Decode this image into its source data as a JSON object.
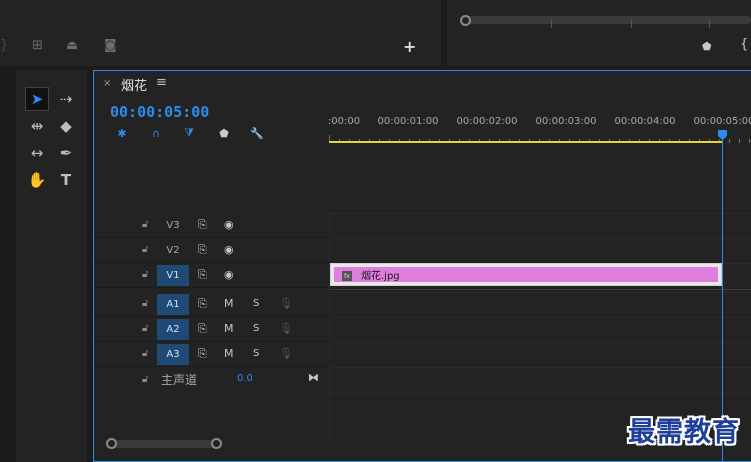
{
  "top_right": {
    "marker_icon": "marker-icon",
    "bracket_icon": "bracket-icon"
  },
  "top_left": {
    "add_label": "+"
  },
  "tools": [
    "selection-tool",
    "track-select-tool",
    "ripple-edit-tool",
    "razor-tool",
    "slip-tool",
    "pen-tool",
    "hand-tool",
    "type-tool"
  ],
  "timeline": {
    "tab_close": "×",
    "tab_title": "烟花",
    "tab_menu": "≡",
    "timecode": "00:00:05:00",
    "ruler_labels": [
      ":00:00",
      "00:00:01:00",
      "00:00:02:00",
      "00:00:03:00",
      "00:00:04:00",
      "00:00:05:00"
    ],
    "tracks": [
      {
        "name": "V3",
        "type": "video",
        "selected": false
      },
      {
        "name": "V2",
        "type": "video",
        "selected": false
      },
      {
        "name": "V1",
        "type": "video",
        "selected": true
      },
      {
        "name": "A1",
        "type": "audio",
        "selected": true
      },
      {
        "name": "A2",
        "type": "audio",
        "selected": true
      },
      {
        "name": "A3",
        "type": "audio",
        "selected": true
      }
    ],
    "mute_label": "M",
    "solo_label": "S",
    "clip": {
      "name": "烟花.jpg",
      "fx": "fx",
      "color": "#de7fde"
    },
    "master": {
      "label": "主声道",
      "value": "0.0"
    }
  },
  "watermark": "最需教育",
  "colors": {
    "accent": "#2d8ceb",
    "clip": "#de7fde",
    "in_out": "#e6d63a"
  }
}
